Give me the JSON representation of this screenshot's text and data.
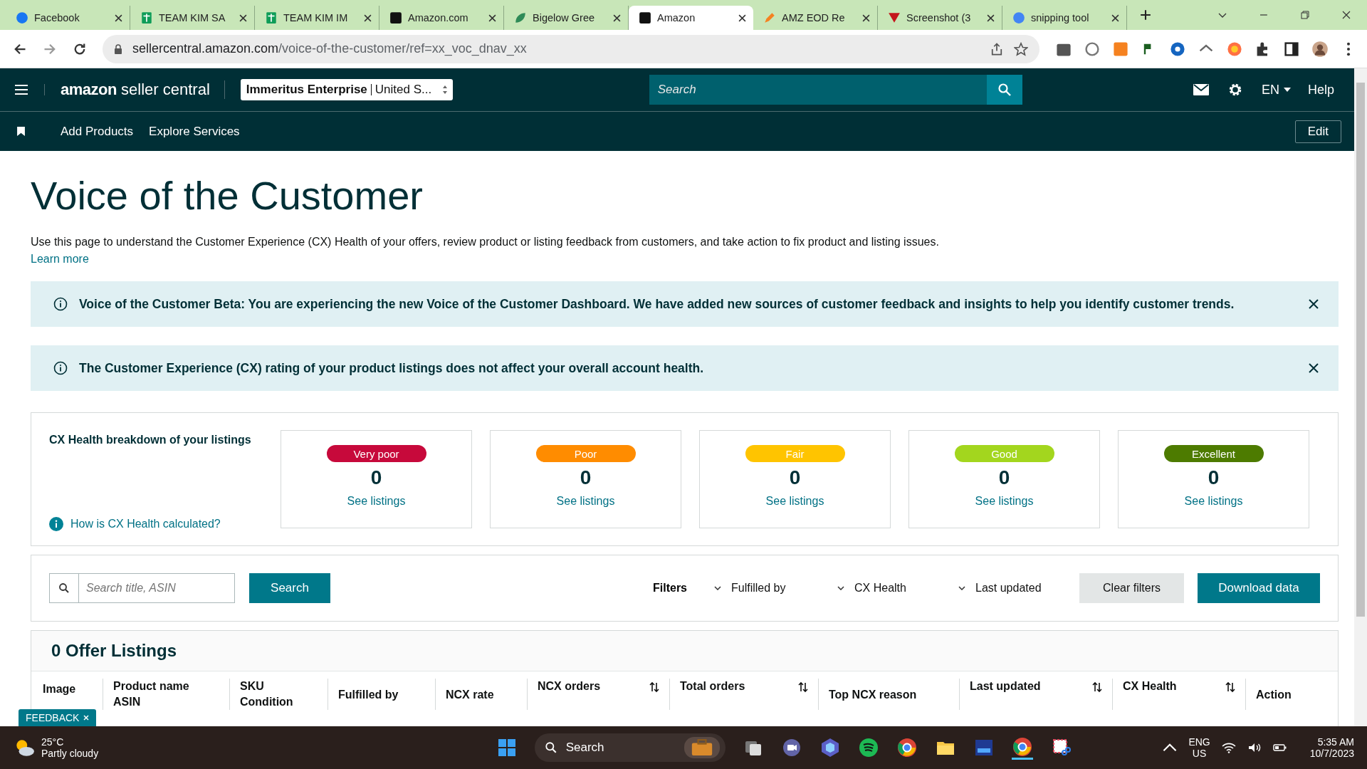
{
  "browser": {
    "tabs": [
      {
        "title": "Facebook",
        "kind": "facebook",
        "selected": false
      },
      {
        "title": "TEAM KIM SA",
        "kind": "sheets",
        "selected": false
      },
      {
        "title": "TEAM KIM IM",
        "kind": "sheets",
        "selected": false
      },
      {
        "title": "Amazon.com",
        "kind": "amazon",
        "selected": false
      },
      {
        "title": "Bigelow Gree",
        "kind": "leaf",
        "selected": false
      },
      {
        "title": "Amazon",
        "kind": "amazon",
        "selected": true
      },
      {
        "title": "AMZ EOD Re",
        "kind": "pencil",
        "selected": false
      },
      {
        "title": "Screenshot (3",
        "kind": "triangle",
        "selected": false
      },
      {
        "title": "snipping tool",
        "kind": "google",
        "selected": false
      }
    ],
    "url_host": "sellercentral.amazon.com",
    "url_path": "/voice-of-the-customer/ref=xx_voc_dnav_xx"
  },
  "header": {
    "logo_brand": "amazon",
    "logo_product": "seller central",
    "account": "Immeritus Enterprise",
    "marketplace": "United S...",
    "search_placeholder": "Search",
    "language": "EN",
    "help": "Help"
  },
  "subnav": {
    "links": [
      "Add Products",
      "Explore Services"
    ],
    "edit": "Edit"
  },
  "page": {
    "title": "Voice of the Customer",
    "description": "Use this page to understand the Customer Experience (CX) Health of your offers, review product or listing feedback from customers, and take action to fix product and listing issues.",
    "learn_more": "Learn more"
  },
  "banners": [
    "Voice of the Customer Beta: You are experiencing the new Voice of the Customer Dashboard. We have added new sources of customer feedback and insights to help you identify customer trends.",
    "The Customer Experience (CX) rating of your product listings does not affect your overall account health."
  ],
  "breakdown": {
    "title": "CX Health breakdown of your listings",
    "help_link": "How is CX Health calculated?",
    "cards": [
      {
        "label": "Very poor",
        "color": "#c7093b",
        "text_dark": false,
        "count": "0",
        "link": "See listings"
      },
      {
        "label": "Poor",
        "color": "#ff8c00",
        "text_dark": false,
        "count": "0",
        "link": "See listings"
      },
      {
        "label": "Fair",
        "color": "#ffc400",
        "text_dark": false,
        "count": "0",
        "link": "See listings"
      },
      {
        "label": "Good",
        "color": "#a3d61e",
        "text_dark": false,
        "count": "0",
        "link": "See listings"
      },
      {
        "label": "Excellent",
        "color": "#4d7b00",
        "text_dark": false,
        "count": "0",
        "link": "See listings"
      }
    ]
  },
  "filters": {
    "search_placeholder": "Search title, ASIN",
    "search_button": "Search",
    "label": "Filters",
    "dropdowns": [
      "Fulfilled by",
      "CX Health",
      "Last updated"
    ],
    "clear": "Clear filters",
    "download": "Download data"
  },
  "listings": {
    "title": "0 Offer Listings",
    "columns": [
      {
        "lines": [
          "Image"
        ],
        "sortable": false
      },
      {
        "lines": [
          "Product name",
          "ASIN"
        ],
        "sortable": false
      },
      {
        "lines": [
          "SKU",
          "Condition"
        ],
        "sortable": false
      },
      {
        "lines": [
          "Fulfilled by"
        ],
        "sortable": false
      },
      {
        "lines": [
          "NCX rate"
        ],
        "sortable": false
      },
      {
        "lines": [
          "NCX orders"
        ],
        "sortable": true
      },
      {
        "lines": [
          "Total orders"
        ],
        "sortable": true
      },
      {
        "lines": [
          "Top NCX reason"
        ],
        "sortable": false
      },
      {
        "lines": [
          "Last updated"
        ],
        "sortable": true
      },
      {
        "lines": [
          "CX Health"
        ],
        "sortable": true
      },
      {
        "lines": [
          "Action"
        ],
        "sortable": false
      }
    ]
  },
  "feedback": "FEEDBACK",
  "taskbar": {
    "temperature": "25°C",
    "weather": "Partly cloudy",
    "search": "Search",
    "lang": "ENG",
    "region": "US",
    "time": "5:35 AM",
    "date": "10/7/2023"
  }
}
